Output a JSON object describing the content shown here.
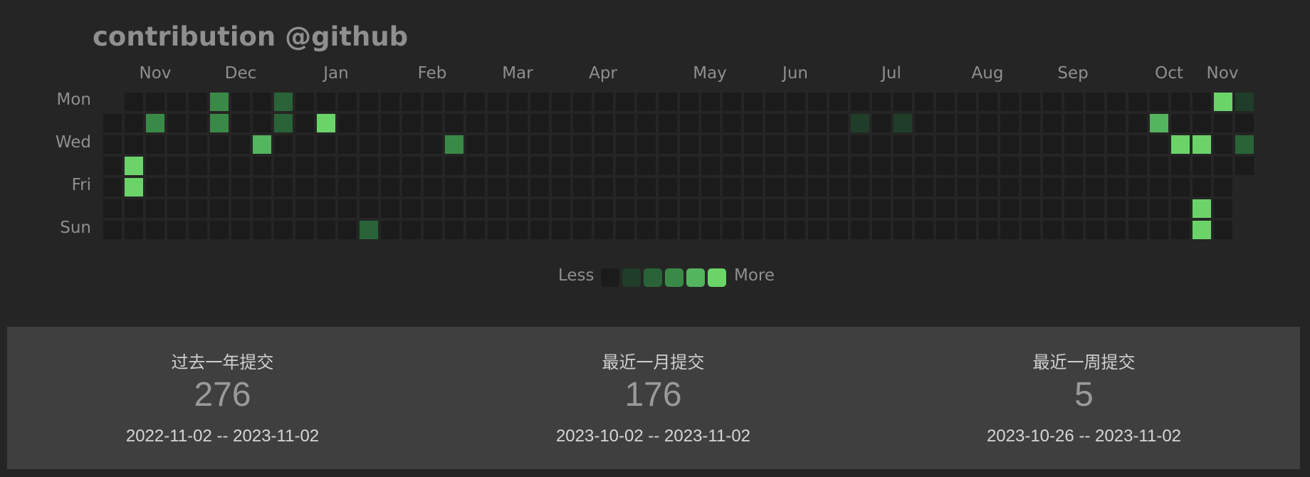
{
  "title": "contribution @github",
  "months": [
    "Nov",
    "Dec",
    "Jan",
    "Feb",
    "Mar",
    "Apr",
    "May",
    "Jun",
    "Jul",
    "Aug",
    "Sep",
    "Oct",
    "Nov"
  ],
  "day_labels": [
    "Mon",
    "Wed",
    "Fri",
    "Sun"
  ],
  "legend": {
    "less": "Less",
    "more": "More",
    "colors": [
      "#1b1b1b",
      "#1f3d28",
      "#2a6337",
      "#3a8a47",
      "#53b55e",
      "#6ad468"
    ]
  },
  "stats": [
    {
      "label": "过去一年提交",
      "value": "276",
      "range": "2022-11-02 -- 2023-11-02"
    },
    {
      "label": "最近一月提交",
      "value": "176",
      "range": "2023-10-02 -- 2023-11-02"
    },
    {
      "label": "最近一周提交",
      "value": "5",
      "range": "2023-10-26 -- 2023-11-02"
    }
  ],
  "grid": {
    "weeks": 53,
    "first_week_start_day": 1,
    "last_week_days": [
      0,
      1,
      2,
      3
    ],
    "active": [
      {
        "week": 5,
        "day": 0,
        "level": 3
      },
      {
        "week": 5,
        "day": 1,
        "level": 3
      },
      {
        "week": 8,
        "day": 0,
        "level": 2
      },
      {
        "week": 8,
        "day": 1,
        "level": 2
      },
      {
        "week": 2,
        "day": 1,
        "level": 3
      },
      {
        "week": 10,
        "day": 1,
        "level": 5
      },
      {
        "week": 7,
        "day": 2,
        "level": 4
      },
      {
        "week": 1,
        "day": 3,
        "level": 5
      },
      {
        "week": 1,
        "day": 4,
        "level": 5
      },
      {
        "week": 12,
        "day": 6,
        "level": 2
      },
      {
        "week": 16,
        "day": 2,
        "level": 3
      },
      {
        "week": 35,
        "day": 1,
        "level": 1
      },
      {
        "week": 37,
        "day": 1,
        "level": 1
      },
      {
        "week": 49,
        "day": 1,
        "level": 4
      },
      {
        "week": 50,
        "day": 2,
        "level": 5
      },
      {
        "week": 51,
        "day": 2,
        "level": 5
      },
      {
        "week": 51,
        "day": 5,
        "level": 5
      },
      {
        "week": 51,
        "day": 6,
        "level": 5
      },
      {
        "week": 52,
        "day": 0,
        "level": 5
      },
      {
        "week": 53,
        "day": 0,
        "level": 1
      },
      {
        "week": 53,
        "day": 2,
        "level": 2
      }
    ]
  }
}
